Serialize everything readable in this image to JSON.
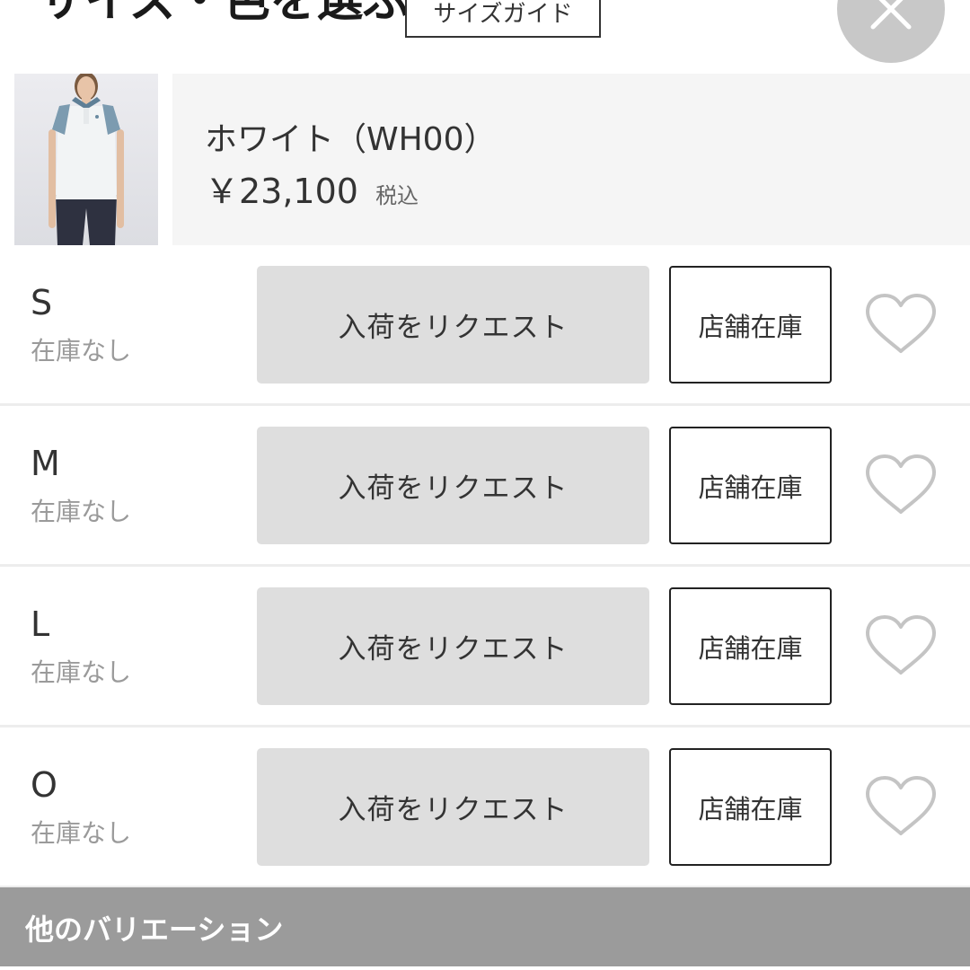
{
  "header": {
    "title": "サイズ・色を選ぶ",
    "size_guide_label": "サイズガイド",
    "close_icon": "close-icon"
  },
  "product": {
    "color_name": "ホワイト（WH00）",
    "price": "￥23,100",
    "tax_label": "税込"
  },
  "sizes": [
    {
      "size": "S",
      "status": "在庫なし",
      "request_label": "入荷をリクエスト",
      "store_label": "店舗在庫",
      "favorite_icon": "heart-icon"
    },
    {
      "size": "M",
      "status": "在庫なし",
      "request_label": "入荷をリクエスト",
      "store_label": "店舗在庫",
      "favorite_icon": "heart-icon"
    },
    {
      "size": "L",
      "status": "在庫なし",
      "request_label": "入荷をリクエスト",
      "store_label": "店舗在庫",
      "favorite_icon": "heart-icon"
    },
    {
      "size": "O",
      "status": "在庫なし",
      "request_label": "入荷をリクエスト",
      "store_label": "店舗在庫",
      "favorite_icon": "heart-icon"
    }
  ],
  "variations": {
    "title": "他のバリエーション"
  },
  "colors": {
    "request_bg": "#dedede",
    "info_bg": "#f5f5f5",
    "variations_bg": "#9b9b9b",
    "close_bg": "#c8c8c8",
    "heart": "#c4c4c4"
  }
}
